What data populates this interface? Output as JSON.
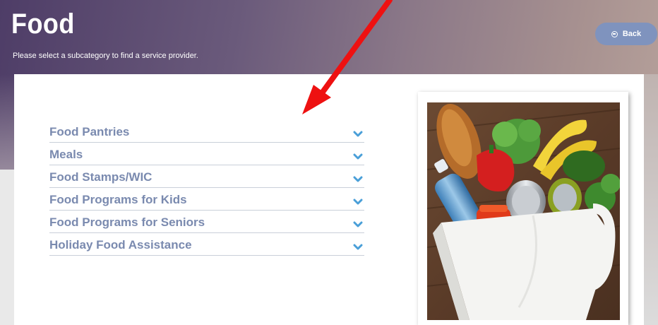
{
  "header": {
    "title": "Food",
    "subtitle": "Please select a subcategory to find a service provider.",
    "back_label": "Back"
  },
  "subcategories": [
    {
      "label": "Food Pantries"
    },
    {
      "label": "Meals"
    },
    {
      "label": "Food Stamps/WIC"
    },
    {
      "label": "Food Programs for Kids"
    },
    {
      "label": "Food Programs for Seniors"
    },
    {
      "label": "Holiday Food Assistance"
    }
  ],
  "colors": {
    "link_text": "#7a8aaf",
    "chevron": "#4a9fd8",
    "back_button": "#7f93be",
    "annotation_arrow": "#ee1111"
  },
  "icons": {
    "back": "circle-minus-icon",
    "expand": "chevron-down-icon",
    "annotation": "red-arrow-icon"
  }
}
